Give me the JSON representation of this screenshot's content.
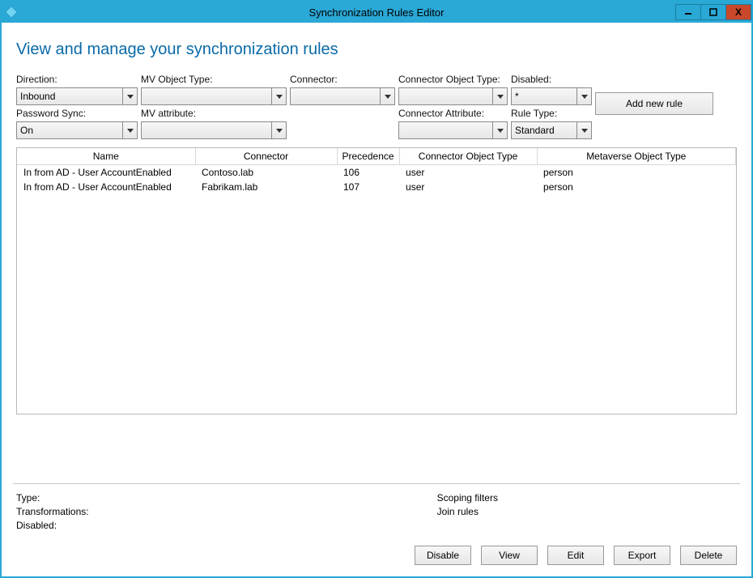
{
  "window": {
    "title": "Synchronization Rules Editor"
  },
  "page": {
    "title": "View and manage your synchronization rules"
  },
  "filters": {
    "direction": {
      "label": "Direction:",
      "value": "Inbound"
    },
    "mv_object_type": {
      "label": "MV Object Type:",
      "value": ""
    },
    "connector": {
      "label": "Connector:",
      "value": ""
    },
    "conn_obj_type": {
      "label": "Connector Object Type:",
      "value": ""
    },
    "disabled": {
      "label": "Disabled:",
      "value": "*"
    },
    "password_sync": {
      "label": "Password Sync:",
      "value": "On"
    },
    "mv_attribute": {
      "label": "MV attribute:",
      "value": ""
    },
    "conn_attribute": {
      "label": "Connector Attribute:",
      "value": ""
    },
    "rule_type": {
      "label": "Rule Type:",
      "value": "Standard"
    }
  },
  "add_button": "Add new rule",
  "table": {
    "headers": {
      "name": "Name",
      "connector": "Connector",
      "precedence": "Precedence",
      "cot": "Connector Object Type",
      "mvt": "Metaverse Object Type"
    },
    "rows": [
      {
        "name": "In from AD - User AccountEnabled",
        "connector": "Contoso.lab",
        "precedence": "106",
        "cot": "user",
        "mvt": "person"
      },
      {
        "name": "In from AD - User AccountEnabled",
        "connector": "Fabrikam.lab",
        "precedence": "107",
        "cot": "user",
        "mvt": "person"
      }
    ]
  },
  "details": {
    "left": {
      "type": "Type:",
      "transformations": "Transformations:",
      "disabled": "Disabled:"
    },
    "right": {
      "scoping": "Scoping filters",
      "join": "Join rules"
    }
  },
  "actions": {
    "disable": "Disable",
    "view": "View",
    "edit": "Edit",
    "export": "Export",
    "delete": "Delete"
  }
}
